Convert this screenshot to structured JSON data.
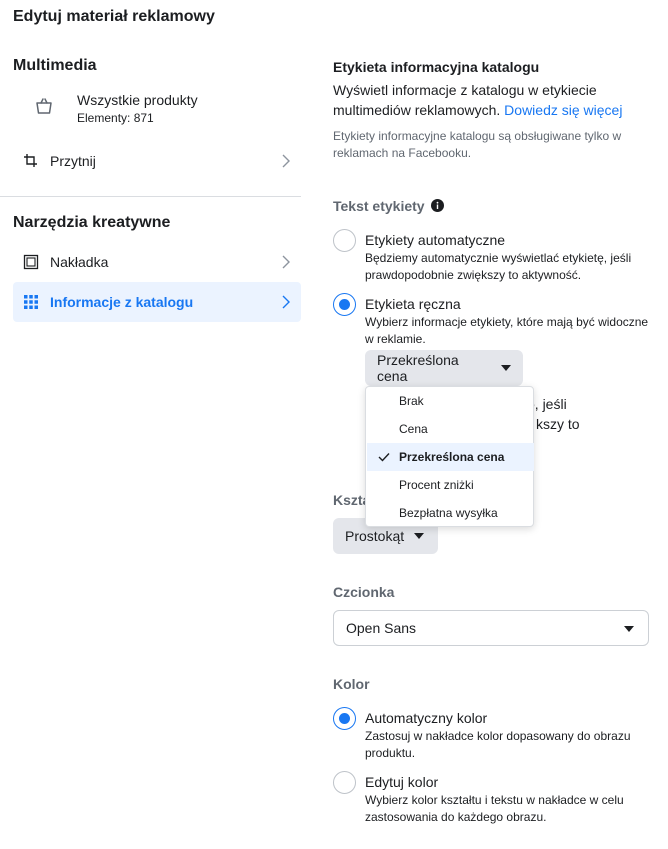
{
  "title": "Edytuj materiał reklamowy",
  "left": {
    "multimedia_heading": "Multimedia",
    "catalog_item": {
      "title": "Wszystkie produkty",
      "subtitle": "Elementy: 871",
      "icon": "shopping-bag-icon"
    },
    "crop": {
      "label": "Przytnij",
      "icon": "crop-icon"
    },
    "tools_heading": "Narzędzia kreatywne",
    "overlay": {
      "label": "Nakładka",
      "icon": "overlay-frame-icon"
    },
    "catalog_info": {
      "label": "Informacje z katalogu",
      "icon": "grid-dots-icon"
    }
  },
  "right": {
    "heading": "Etykieta informacyjna katalogu",
    "desc": "Wyświetl informacje z katalogu w etykiecie multimediów reklamowych.",
    "learn_more": "Dowiedz się więcej",
    "note": "Etykiety informacyjne katalogu są obsługiwane tylko w reklamach na Facebooku.",
    "label_text_heading": "Tekst etykiety",
    "auto_label": {
      "title": "Etykiety automatyczne",
      "desc": "Będziemy automatycznie wyświetlać etykietę, jeśli prawdopodobnie zwiększy to aktywność."
    },
    "manual_label": {
      "title": "Etykieta ręczna",
      "desc": "Wybierz informacje etykiety, które mają być widoczne w reklamie."
    },
    "label_dropdown": {
      "value": "Przekreślona cena"
    },
    "hidden_text_line1": "ko, jeśli",
    "hidden_text_line2": "kszy to",
    "shape_heading_partial": "Kszta",
    "shape_button": "Prostokąt",
    "font_heading": "Czcionka",
    "font_value": "Open Sans",
    "color_heading": "Kolor",
    "auto_color": {
      "title": "Automatyczny kolor",
      "desc": "Zastosuj w nakładce kolor dopasowany do obrazu produktu."
    },
    "edit_color": {
      "title": "Edytuj kolor",
      "desc": "Wybierz kolor kształtu i tekstu w nakładce w celu zastosowania do każdego obrazu."
    }
  },
  "menu": {
    "items": [
      "Brak",
      "Cena",
      "Przekreślona cena",
      "Procent zniżki",
      "Bezpłatna wysyłka"
    ],
    "selected": "Przekreślona cena"
  },
  "colors": {
    "accent": "#1877f2",
    "active_bg": "#ebf3ff"
  }
}
